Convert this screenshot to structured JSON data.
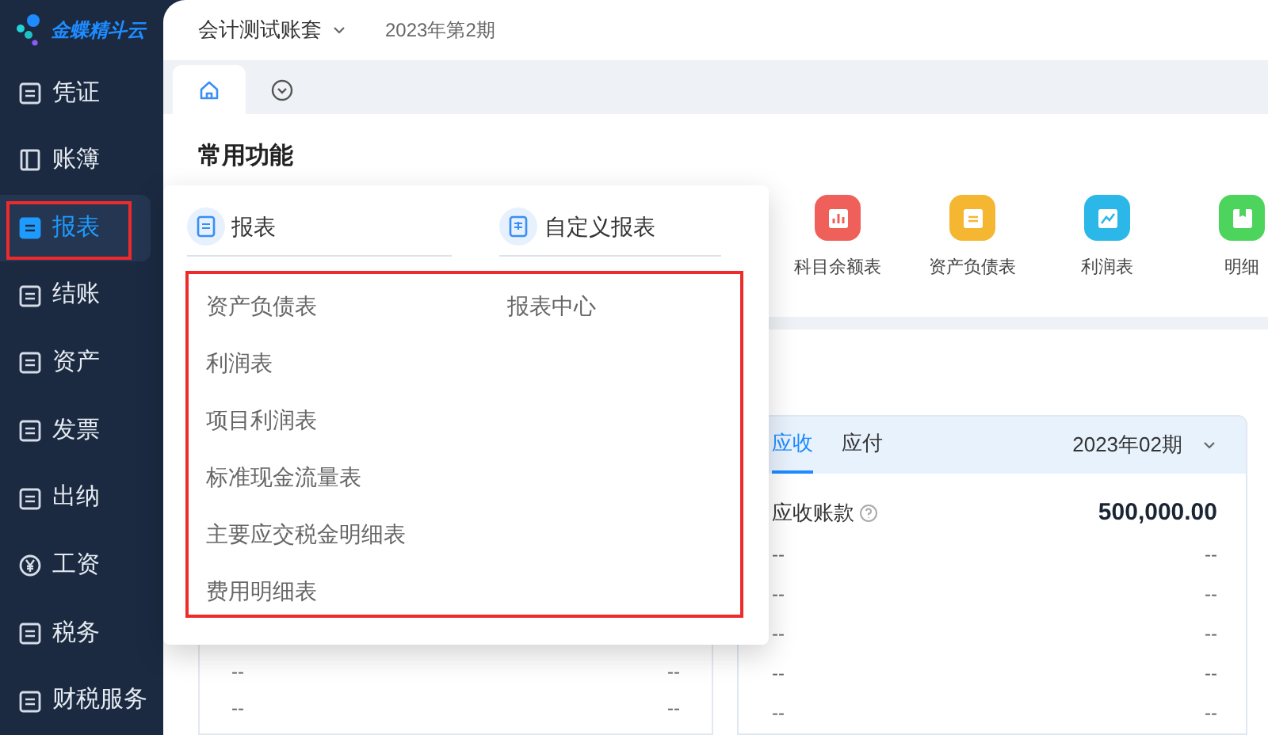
{
  "logo": {
    "text": "金蝶精斗云"
  },
  "sidebar": {
    "items": [
      {
        "label": "凭证",
        "selected": false,
        "kind": "doc"
      },
      {
        "label": "账簿",
        "selected": false,
        "kind": "book"
      },
      {
        "label": "报表",
        "selected": true,
        "kind": "doc"
      },
      {
        "label": "结账",
        "selected": false,
        "kind": "doc"
      },
      {
        "label": "资产",
        "selected": false,
        "kind": "doc"
      },
      {
        "label": "发票",
        "selected": false,
        "kind": "doc"
      },
      {
        "label": "出纳",
        "selected": false,
        "kind": "doc"
      },
      {
        "label": "工资",
        "selected": false,
        "kind": "yen"
      },
      {
        "label": "税务",
        "selected": false,
        "kind": "doc"
      },
      {
        "label": "财税服务",
        "selected": false,
        "kind": "doc"
      }
    ]
  },
  "header": {
    "account_set": "会计测试账套",
    "period": "2023年第2期"
  },
  "tabs": [
    {
      "kind": "home",
      "selected": true
    },
    {
      "kind": "more",
      "selected": false
    }
  ],
  "section_title": "常用功能",
  "shortcuts": [
    {
      "label": "科目余额表",
      "color": "#f0605a"
    },
    {
      "label": "资产负债表",
      "color": "#f5b731"
    },
    {
      "label": "利润表",
      "color": "#2bb8e8"
    },
    {
      "label": "明细",
      "color": "#4cd45c"
    }
  ],
  "popover": {
    "groups": [
      {
        "title": "报表",
        "items": [
          "资产负债表",
          "利润表",
          "项目利润表",
          "标准现金流量表",
          "主要应交税金明细表",
          "费用明细表"
        ]
      },
      {
        "title": "自定义报表",
        "items": [
          "报表中心"
        ]
      }
    ]
  },
  "left_card": {
    "rows": [
      {
        "label": "--",
        "value": "--"
      },
      {
        "label": "--",
        "value": "--"
      }
    ]
  },
  "right_card": {
    "tabs": [
      {
        "label": "应收",
        "selected": true
      },
      {
        "label": "应付",
        "selected": false
      }
    ],
    "period": "2023年02期",
    "rows": [
      {
        "kind": "total",
        "label": "应收账款",
        "value": "500,000.00"
      },
      {
        "kind": "plain",
        "label": "--",
        "value": "--"
      },
      {
        "kind": "plain",
        "label": "--",
        "value": "--"
      },
      {
        "kind": "plain",
        "label": "--",
        "value": "--"
      },
      {
        "kind": "plain",
        "label": "--",
        "value": "--"
      },
      {
        "kind": "plain",
        "label": "--",
        "value": "--"
      }
    ]
  }
}
